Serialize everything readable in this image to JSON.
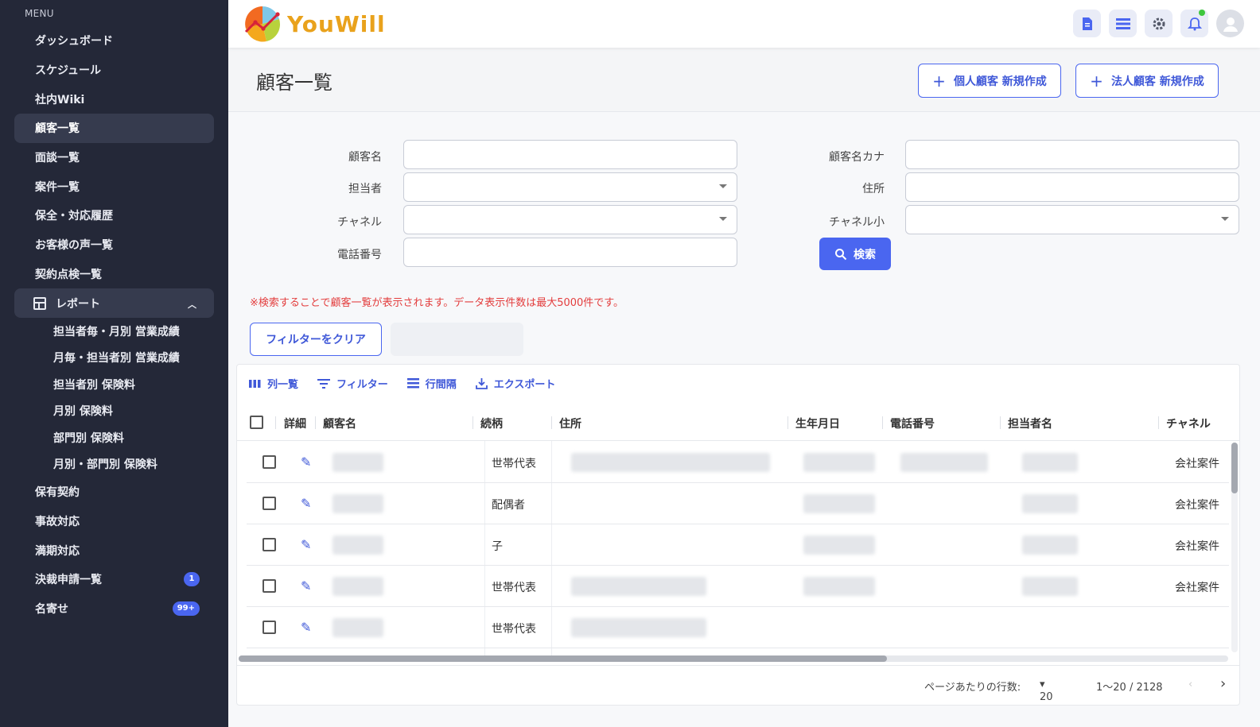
{
  "sidebar": {
    "menu_heading": "MENU",
    "items": [
      {
        "label": "ダッシュボード"
      },
      {
        "label": "スケジュール"
      },
      {
        "label": "社内Wiki"
      },
      {
        "label": "顧客一覧"
      },
      {
        "label": "面談一覧"
      },
      {
        "label": "案件一覧"
      },
      {
        "label": "保全・対応履歴"
      },
      {
        "label": "お客様の声一覧"
      },
      {
        "label": "契約点検一覧"
      }
    ],
    "report": {
      "label": "レポート",
      "sub": [
        {
          "label": "担当者毎・月別 営業成績"
        },
        {
          "label": "月毎・担当者別 営業成績"
        },
        {
          "label": "担当者別 保険料"
        },
        {
          "label": "月別 保険料"
        },
        {
          "label": "部門別 保険料"
        },
        {
          "label": "月別・部門別 保険料"
        }
      ]
    },
    "bottom_items": [
      {
        "label": "保有契約",
        "badge": ""
      },
      {
        "label": "事故対応",
        "badge": ""
      },
      {
        "label": "満期対応",
        "badge": ""
      },
      {
        "label": "決裁申請一覧",
        "badge": "1"
      },
      {
        "label": "名寄せ",
        "badge": "99+"
      }
    ]
  },
  "header": {
    "logo_text": "YouWill",
    "icons": [
      "document-icon",
      "list-icon",
      "gear-icon",
      "bell-icon",
      "user-icon"
    ]
  },
  "page": {
    "title": "顧客一覧",
    "btn_individual": "個人顧客 新規作成",
    "btn_corporate": "法人顧客 新規作成"
  },
  "form": {
    "name_label": "顧客名",
    "kana_label": "顧客名カナ",
    "staff_label": "担当者",
    "address_label": "住所",
    "channel_label": "チャネル",
    "channel_small_label": "チャネル小",
    "phone_label": "電話番号",
    "search_btn": "検索",
    "note": "※検索することで顧客一覧が表示されます。データ表示件数は最大5000件です。",
    "clear_btn": "フィルターをクリア"
  },
  "toolbar": {
    "columns": "列一覧",
    "filter": "フィルター",
    "density": "行間隔",
    "export": "エクスポート"
  },
  "table": {
    "headers": [
      "詳細",
      "顧客名",
      "続柄",
      "住所",
      "生年月日",
      "電話番号",
      "担当者名",
      "チャネル"
    ],
    "rows": [
      {
        "relation": "世帯代表",
        "channel": "会社案件"
      },
      {
        "relation": "配偶者",
        "channel": "会社案件"
      },
      {
        "relation": "子",
        "channel": "会社案件"
      },
      {
        "relation": "世帯代表",
        "channel": "会社案件"
      },
      {
        "relation": "世帯代表",
        "channel": ""
      }
    ]
  },
  "pagination": {
    "rows_label": "ページあたりの行数:",
    "rows_value": "20",
    "range": "1〜20 / 2128"
  },
  "colors": {
    "accent": "#4a66f0",
    "sidebar_bg": "#242838",
    "logo": "#e9a21c",
    "note": "#e33d3d"
  }
}
